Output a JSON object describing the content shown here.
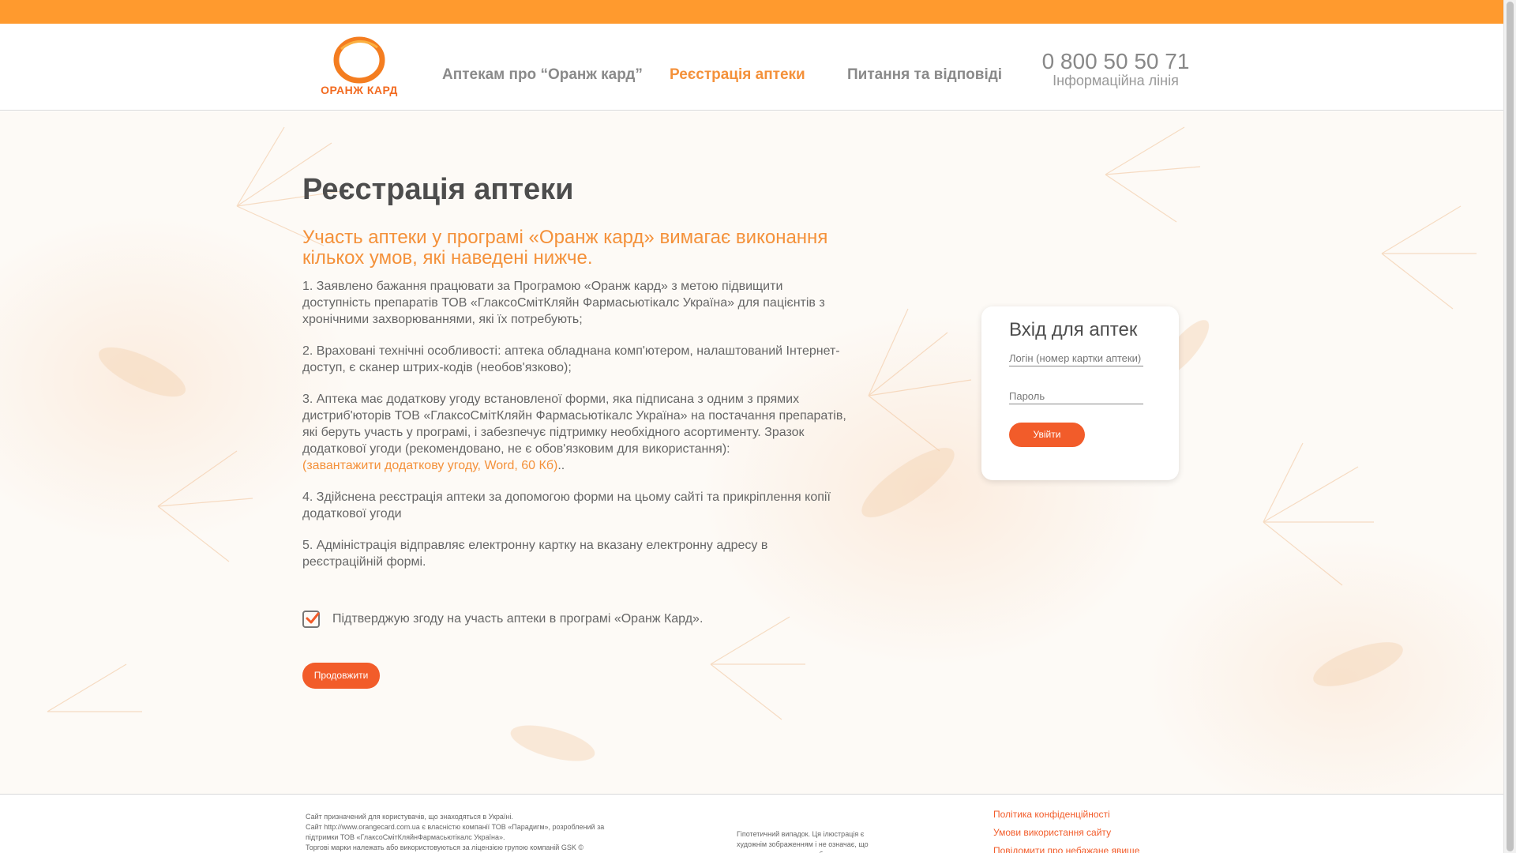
{
  "brand": {
    "name": "ОРАНЖ КАРД",
    "accent": "#ff9a2e",
    "orange_text": "#f4913a",
    "button_color": "#f25c2a"
  },
  "nav": {
    "items": [
      {
        "label": "Аптекам про “Оранж кард”",
        "active": false
      },
      {
        "label": "Реєстрація аптеки",
        "active": true
      },
      {
        "label": "Питання та відповіді",
        "active": false
      }
    ]
  },
  "phone": {
    "number": "0 800 50 50 71",
    "caption": "Інформаційна лінія"
  },
  "main": {
    "title": "Реєстрація аптеки",
    "intro": "Участь аптеки у програмі «Оранж кард» вимагає виконання кількох умов, які наведені нижче.",
    "conditions": [
      "1. Заявлено бажання працювати за Програмою «Оранж кард» з метою підвищити доступність препаратів ТОВ «ГлаксоСмітКляйн Фармасьютікалс Україна» для пацієнтів з хронічними захворюваннями, які їх потребують;",
      "2. Враховані технічні особливості: аптека обладнана комп'ютером, налаштований Інтернет-доступ, є сканер штрих-кодів (необов'язково);",
      "3. Аптека має додаткову угоду встановленої форми, яка підписана з одним з прямих дистриб'юторів ТОВ «ГлаксоСмітКляйн Фармасьютікалс Україна» на постачання препаратів, які беруть участь у програмі, і забезпечує підтримку необхідного асортименту. Зразок додаткової угоди (рекомендовано, не є обов'язковим для використання):",
      "4. Здійснена реєстрація аптеки за допомогою форми на цьому сайті та прикріплення копії додаткової угоди",
      "5. Адміністрація відправляє електронну картку на вказану електронну адресу в реєстраційній формі."
    ],
    "download_link": "(завантажити додаткову угоду, Word, 60 Кб)",
    "download_suffix": "..",
    "agree_checked": true,
    "agree_label": "Підтверджую згоду на участь аптеки в програмі «Оранж Кард».",
    "continue_label": "Продовжити"
  },
  "login": {
    "title": "Вхід для аптек",
    "login_placeholder": "Логін (номер картки аптеки)",
    "password_placeholder": "Пароль",
    "submit_label": "Увійти"
  },
  "footer": {
    "left": [
      "Сайт призначений для користувачів, що знаходяться в Україні.",
      "Сайт http://www.orangecard.com.ua є власністю компанії ТОВ «Парадигм», розроблений за підтримки ТОВ «ГлаксоСмітКляйнФармасьютікалс Україна».",
      "Торгові марки належать або використовуються за ліцензією групою компаній GSK ©"
    ],
    "middle": "Гіпотетичний випадок. Ця ілюстрація є художнім зображенням і не означає, що модель страждає цим небуттям",
    "links": [
      "Політика конфіденційності",
      "Умови використання сайту",
      "Повідомити про небажане явище"
    ]
  }
}
